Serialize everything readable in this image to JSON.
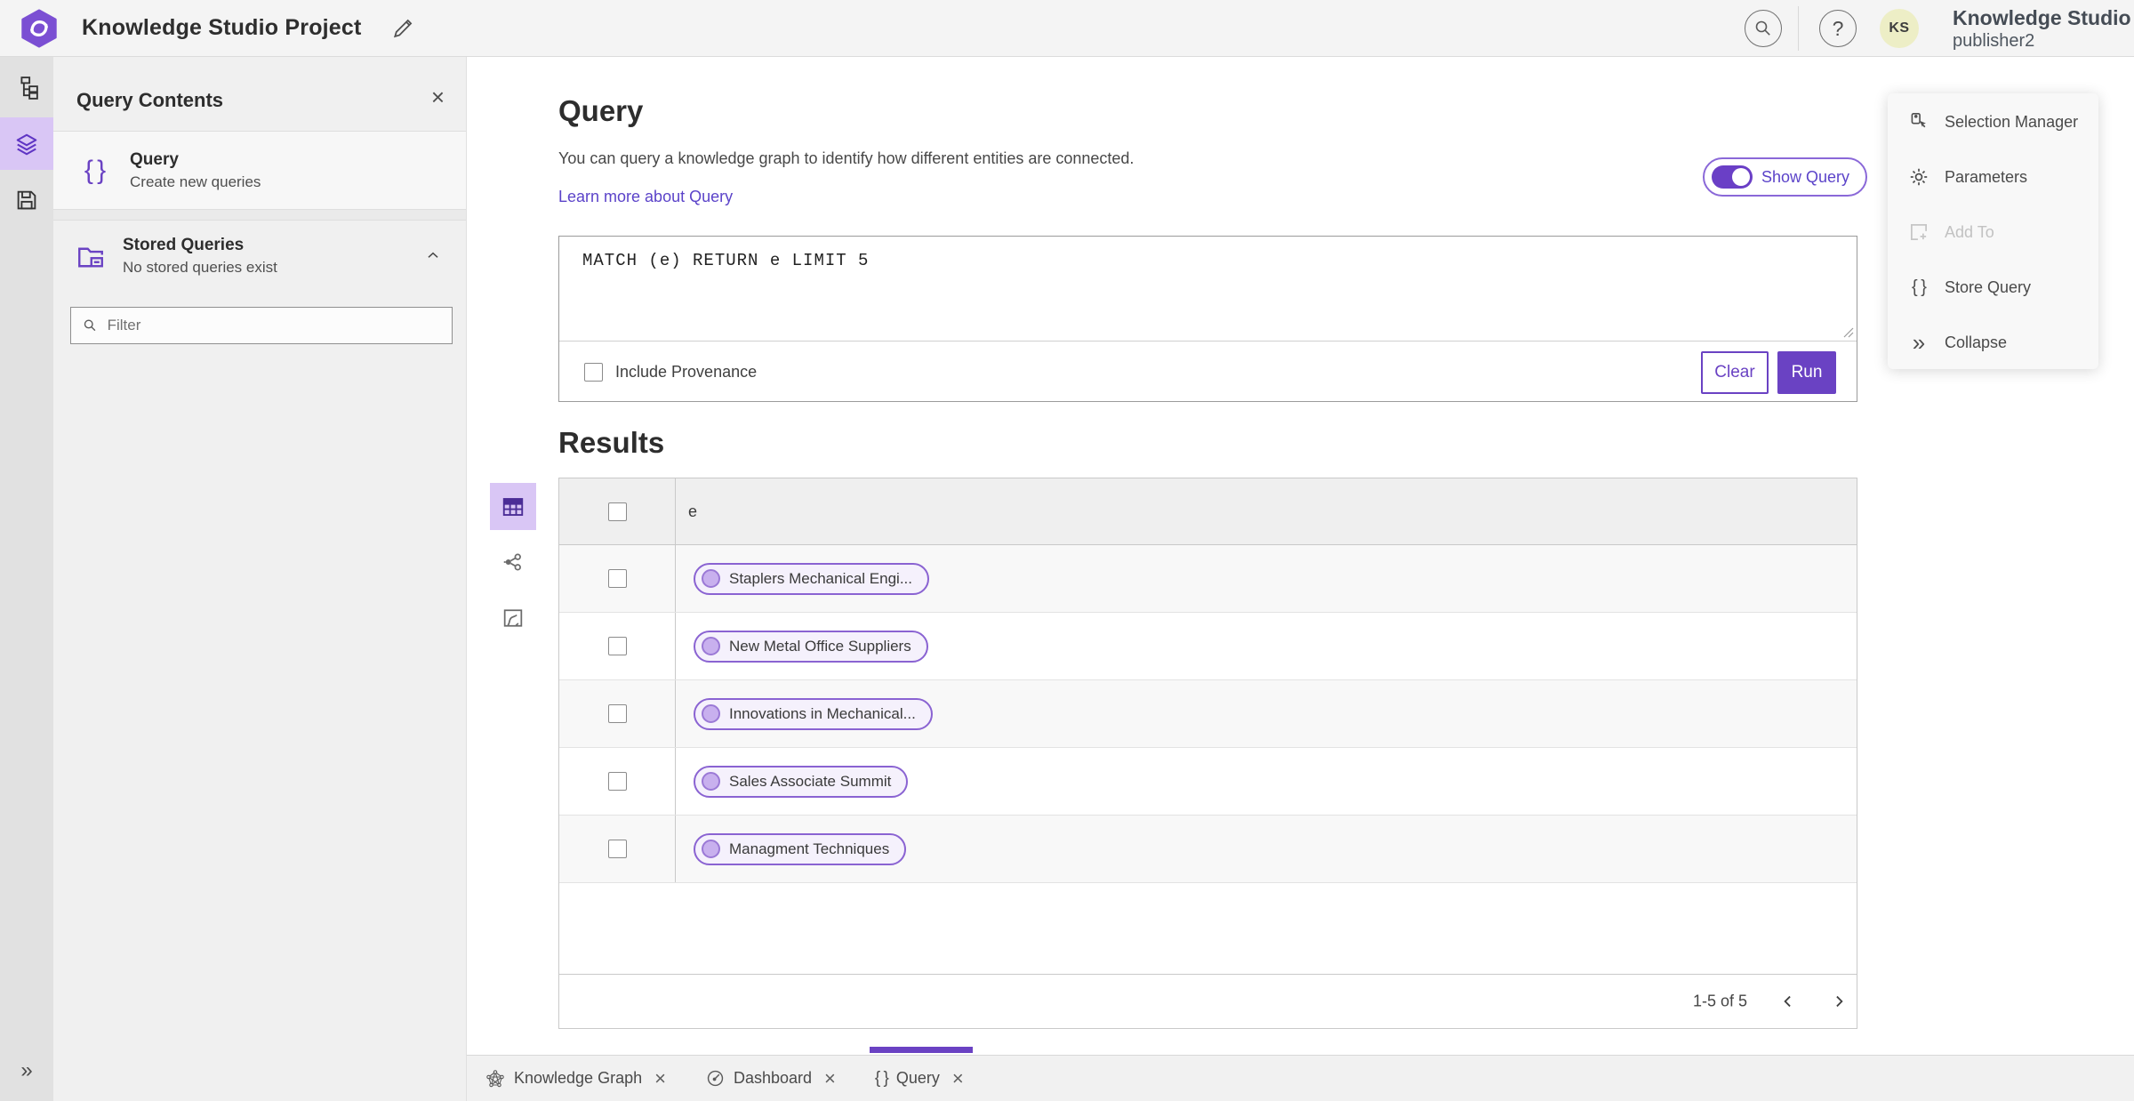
{
  "topbar": {
    "project_title": "Knowledge Studio Project",
    "org_name": "Knowledge Studio",
    "user_name": "publisher2",
    "avatar_initials": "KS"
  },
  "icons": {
    "close": "×",
    "help": "?",
    "braces": "{ }",
    "collapse": "»"
  },
  "sidebar": {
    "title": "Query Contents",
    "query_item": {
      "title": "Query",
      "subtitle": "Create new queries"
    },
    "stored_queries": {
      "title": "Stored Queries",
      "subtitle": "No stored queries exist"
    },
    "filter_placeholder": "Filter"
  },
  "query_panel": {
    "heading": "Query",
    "description": "You can query a knowledge graph to identify how different entities are connected.",
    "learn_more_label": "Learn more about Query",
    "show_query_label": "Show Query",
    "query_text": "MATCH (e) RETURN e LIMIT 5",
    "include_provenance_label": "Include Provenance",
    "clear_label": "Clear",
    "run_label": "Run"
  },
  "results": {
    "heading": "Results",
    "column_header": "e",
    "rows": [
      {
        "label": "Staplers Mechanical Engi..."
      },
      {
        "label": "New Metal Office Suppliers"
      },
      {
        "label": "Innovations in Mechanical..."
      },
      {
        "label": "Sales Associate Summit"
      },
      {
        "label": "Managment Techniques"
      }
    ],
    "pagination_label": "1-5 of 5"
  },
  "side_menu": {
    "items": [
      {
        "label": "Selection Manager",
        "disabled": false
      },
      {
        "label": "Parameters",
        "disabled": false
      },
      {
        "label": "Add To",
        "disabled": true
      },
      {
        "label": "Store Query",
        "disabled": false
      },
      {
        "label": "Collapse",
        "disabled": false
      }
    ]
  },
  "bottom_tabs": [
    {
      "label": "Knowledge Graph",
      "active": false
    },
    {
      "label": "Dashboard",
      "active": false
    },
    {
      "label": "Query",
      "active": true
    }
  ],
  "colors": {
    "accent": "#6a42c3",
    "accent_light": "#d9c6f5",
    "pill_bg": "#f5f1fc",
    "pill_border": "#8a63d2",
    "avatar_bg": "#edeec6"
  }
}
